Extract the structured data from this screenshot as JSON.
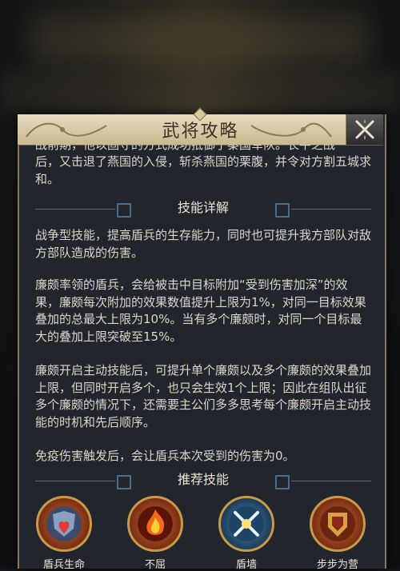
{
  "panel": {
    "title": "武将攻略",
    "close_icon": "close-x-icon"
  },
  "intro": {
    "line_partial": "战前期，他以固守的方式成功抵御了秦国军队。长平之战",
    "text": "后，又击退了燕国的入侵，斩杀燕国的栗腹，并令对方割五城求和。"
  },
  "skill_detail": {
    "header": "技能详解",
    "paragraphs": [
      "战争型技能，提高盾兵的生存能力，同时也可提升我方部队对敌方部队造成的伤害。",
      "廉颇率领的盾兵，会给被击中目标附加“受到伤害加深”的效果，廉颇每次附加的效果数值提升上限为1%，对同一目标效果叠加的总最大上限为10%。当有多个廉颇时，对同一个目标最大的叠加上限突破至15%。",
      "廉颇开启主动技能后，可提升单个廉颇以及多个廉颇的效果叠加上限，但同时开启多个，也只会生效1个上限；因此在组队出征多个廉颇的情况下，还需要主公们多多思考每个廉颇开启主动技能的时机和先后顺序。",
      "免疫伤害触发后，会让盾兵本次受到的伤害为0。"
    ]
  },
  "recommended": {
    "header": "推荐技能",
    "skills": [
      {
        "name": "盾兵生命",
        "icon": "shield-heart-icon",
        "color": "#c0392b"
      },
      {
        "name": "不屈",
        "icon": "flame-warrior-icon",
        "color": "#b8321c"
      },
      {
        "name": "盾墙",
        "icon": "crossed-swords-icon",
        "color": "#3d7fb0"
      },
      {
        "name": "步步为营",
        "icon": "fortress-shield-icon",
        "color": "#c2502a"
      }
    ]
  }
}
